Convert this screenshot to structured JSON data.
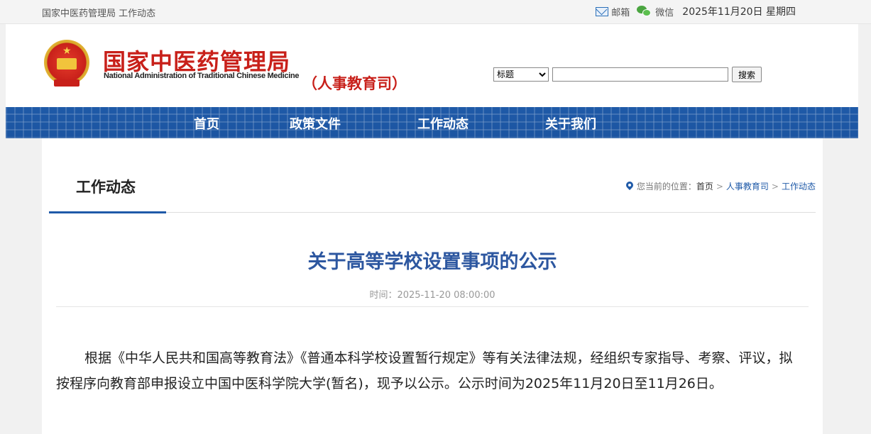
{
  "topbar": {
    "breadcrumb": "国家中医药管理局 工作动态",
    "mail_label": "邮箱",
    "wechat_label": "微信",
    "date": "2025年11月20日 星期四"
  },
  "header": {
    "org_name_cn": "国家中医药管理局",
    "org_name_en": "National Administration of Traditional Chinese Medicine",
    "department": "（人事教育司）",
    "search_type": "标题",
    "search_button": "搜索"
  },
  "nav": {
    "items": [
      {
        "label": "首页"
      },
      {
        "label": "政策文件"
      },
      {
        "label": "工作动态"
      },
      {
        "label": "关于我们"
      }
    ]
  },
  "section": {
    "title": "工作动态",
    "location_label": "您当前的位置：",
    "location": [
      "首页",
      "人事教育司",
      "工作动态"
    ]
  },
  "article": {
    "title": "关于高等学校设置事项的公示",
    "time": "时间：2025-11-20 08:00:00",
    "body": "根据《中华人民共和国高等教育法》《普通本科学校设置暂行规定》等有关法律法规，经组织专家指导、考察、评议，拟按程序向教育部申报设立中国中医科学院大学(暂名)，现予以公示。公示时间为2025年11月20日至11月26日。"
  },
  "colors": {
    "brand_red": "#c8201a",
    "brand_blue": "#1f5aa8",
    "title_blue": "#2d57a0"
  }
}
